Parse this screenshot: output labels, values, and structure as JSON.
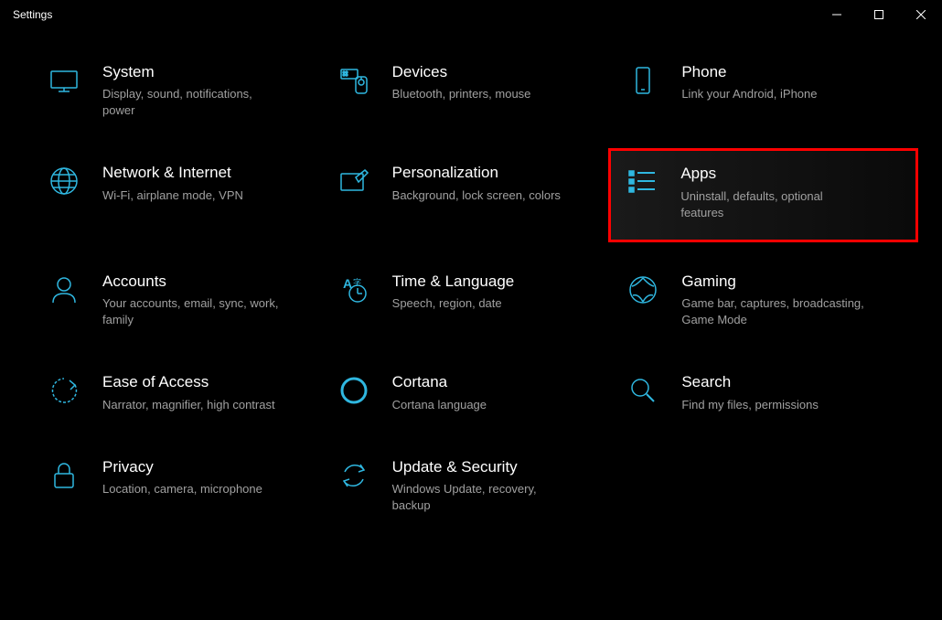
{
  "window": {
    "title": "Settings"
  },
  "tiles": {
    "system": {
      "title": "System",
      "desc": "Display, sound, notifications, power"
    },
    "devices": {
      "title": "Devices",
      "desc": "Bluetooth, printers, mouse"
    },
    "phone": {
      "title": "Phone",
      "desc": "Link your Android, iPhone"
    },
    "network": {
      "title": "Network & Internet",
      "desc": "Wi-Fi, airplane mode, VPN"
    },
    "personalization": {
      "title": "Personalization",
      "desc": "Background, lock screen, colors"
    },
    "apps": {
      "title": "Apps",
      "desc": "Uninstall, defaults, optional features"
    },
    "accounts": {
      "title": "Accounts",
      "desc": "Your accounts, email, sync, work, family"
    },
    "time": {
      "title": "Time & Language",
      "desc": "Speech, region, date"
    },
    "gaming": {
      "title": "Gaming",
      "desc": "Game bar, captures, broadcasting, Game Mode"
    },
    "ease": {
      "title": "Ease of Access",
      "desc": "Narrator, magnifier, high contrast"
    },
    "cortana": {
      "title": "Cortana",
      "desc": "Cortana language"
    },
    "search": {
      "title": "Search",
      "desc": "Find my files, permissions"
    },
    "privacy": {
      "title": "Privacy",
      "desc": "Location, camera, microphone"
    },
    "update": {
      "title": "Update & Security",
      "desc": "Windows Update, recovery, backup"
    }
  }
}
